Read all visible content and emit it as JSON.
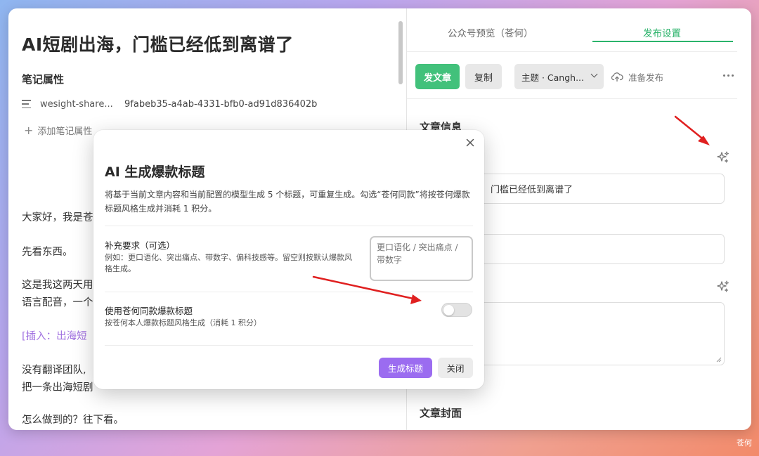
{
  "editor": {
    "doc_title": "AI短剧出海，门槛已经低到离谱了",
    "props_heading": "笔记属性",
    "property": {
      "key": "wesight-share...",
      "value": "9fabeb35-a4ab-4331-bfb0-ad91d836402b"
    },
    "add_property": "添加笔记属性",
    "paragraphs": [
      "大家好，我是苍",
      "先看东西。",
      "这是我这两天用",
      "语言配音，一个",
      "[插入：出海短",
      "没有翻译团队,",
      "把一条出海短剧",
      "怎么做到的？往下看。"
    ]
  },
  "panel": {
    "tabs": [
      {
        "label": "公众号预览（苍何）",
        "active": false
      },
      {
        "label": "发布设置",
        "active": true
      }
    ],
    "toolbar": {
      "publish": "发文章",
      "copy": "复制",
      "theme": "主题 · Cangh...",
      "status": "准备发布"
    },
    "article_info_title": "文章信息",
    "title_field_value": "门槛已经低到离谱了",
    "cover_title": "文章封面"
  },
  "modal": {
    "title": "AI 生成爆款标题",
    "description": "将基于当前文章内容和当前配置的模型生成 5 个标题，可重复生成。勾选“苍何同款”将按苍何爆款标题风格生成并消耗 1 积分。",
    "requirement_label": "补充要求（可选）",
    "requirement_hint": "例如：更口语化、突出痛点、带数字、偏科技感等。留空则按默认爆款风格生成。",
    "requirement_placeholder": "更口语化 / 突出痛点 / 带数字",
    "style_label": "使用苍何同款爆款标题",
    "style_hint": "按苍何本人爆款标题风格生成（消耗 1 积分）",
    "style_enabled": false,
    "generate_button": "生成标题",
    "close_button": "关闭"
  },
  "colors": {
    "accent_green": "#42c17b",
    "accent_purple": "#9b6cf0",
    "arrow_red": "#e02020"
  },
  "watermark": "苍何"
}
